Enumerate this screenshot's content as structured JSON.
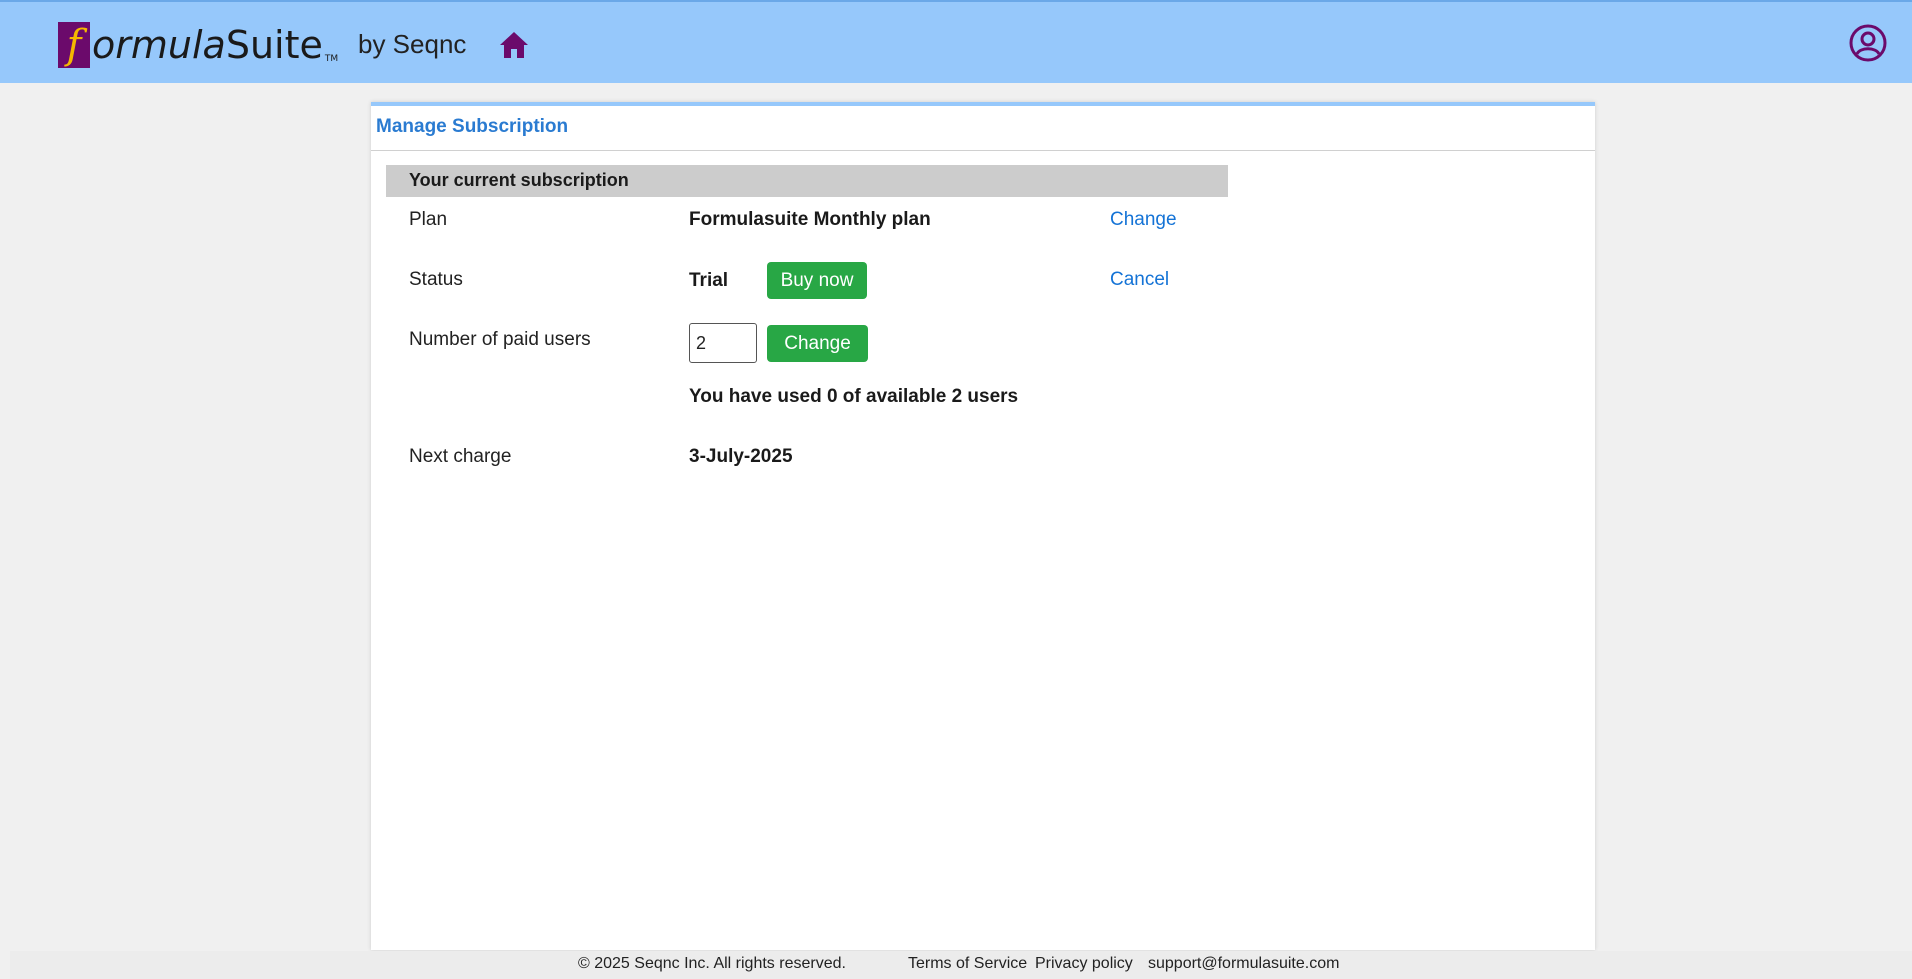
{
  "header": {
    "logo_f": "f",
    "logo_ormula": "ormula",
    "logo_suite": "Suite",
    "logo_tm": "TM",
    "by_text": "by Seqnc",
    "home_icon": "home-icon",
    "user_icon": "user-circle-icon",
    "bg_color": "#96c8fb"
  },
  "panel": {
    "title": "Manage Subscription",
    "section_title": "Your current subscription",
    "plan": {
      "label": "Plan",
      "value": "Formulasuite Monthly plan",
      "action": "Change"
    },
    "status": {
      "label": "Status",
      "value": "Trial",
      "buy_button": "Buy now",
      "action": "Cancel"
    },
    "users": {
      "label": "Number of paid users",
      "input_value": "2",
      "change_button": "Change",
      "usage_note": "You have used 0 of available 2 users"
    },
    "next_charge": {
      "label": "Next charge",
      "value": "3-July-2025"
    }
  },
  "footer": {
    "copyright": "© 2025 Seqnc Inc. All rights reserved.",
    "terms": "Terms of Service",
    "privacy": "Privacy policy",
    "support_email": "support@formulasuite.com"
  },
  "colors": {
    "accent_green": "#28a745",
    "link_blue": "#1473d6",
    "brand_purple": "#6b0a6b"
  }
}
